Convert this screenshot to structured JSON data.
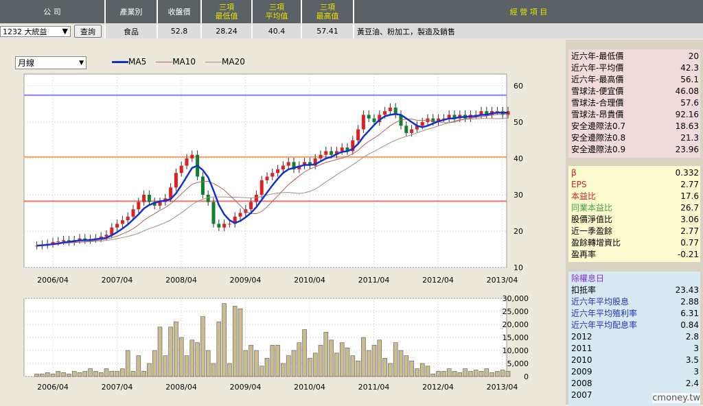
{
  "header": {
    "company": "公 司",
    "industry": "產業別",
    "close": "收盤價",
    "low3": "三項\n最低值",
    "avg3": "三項\n平均值",
    "high3": "三項\n最高值",
    "business": "經 營 項 目"
  },
  "row": {
    "stock": "1232 大統益",
    "query": "查詢",
    "industry": "食品",
    "close": "52.8",
    "low3": "28.24",
    "avg3": "40.4",
    "high3": "57.41",
    "business": "黃豆油、粉加工，製造及銷售"
  },
  "controls": {
    "period": "月線",
    "legend": [
      "MA5",
      "MA10",
      "MA20"
    ]
  },
  "colors": {
    "ma5": "#1030d0",
    "ma10": "#b06060",
    "ma20": "#a09080",
    "up": "#e02020",
    "down": "#108030",
    "hi": "#8080ff",
    "avg": "#f0a060",
    "lo": "#f07070"
  },
  "panel1": [
    [
      "近六年-最低價",
      "20"
    ],
    [
      "近六年-平均價",
      "42.3"
    ],
    [
      "近六年-最高價",
      "56.1"
    ],
    [
      "雪球法-便宜價",
      "46.08"
    ],
    [
      "雪球法-合理價",
      "57.6"
    ],
    [
      "雪球法-昂貴價",
      "92.16"
    ],
    [
      "安全邊際法0.7",
      "18.63"
    ],
    [
      "安全邊際法0.8",
      "21.3"
    ],
    [
      "安全邊際法0.9",
      "23.96"
    ]
  ],
  "panel2": [
    [
      "β",
      "0.332"
    ],
    [
      "EPS",
      "2.77"
    ],
    [
      "本益比",
      "17.6"
    ],
    [
      "同業本益比",
      "26.7"
    ],
    [
      "股價淨值比",
      "3.06"
    ],
    [
      "近一季盈餘",
      "2.77"
    ],
    [
      "盈餘轉增資比",
      "0.77"
    ],
    [
      "盈再率",
      "-0.21"
    ]
  ],
  "panel3": [
    [
      "除權息日",
      ""
    ],
    [
      "扣抵率",
      "23.43"
    ],
    [
      "近六年平均股息",
      "2.88"
    ],
    [
      "近六年平均殖利率",
      "6.31"
    ],
    [
      "近六年平均配息率",
      "0.84"
    ],
    [
      "2012",
      "2.8"
    ],
    [
      "2011",
      "3"
    ],
    [
      "2010",
      "3.5"
    ],
    [
      "2009",
      "3"
    ],
    [
      "2008",
      "2.4"
    ],
    [
      "2007",
      ""
    ]
  ],
  "watermark": "cmoney.tw",
  "chart_data": {
    "type": "candlestick",
    "x_ticks": [
      "2006/04",
      "2007/04",
      "2008/04",
      "2009/04",
      "2010/04",
      "2011/04",
      "2012/04",
      "2013/04"
    ],
    "price_ticks": [
      10,
      20,
      30,
      40,
      50,
      60
    ],
    "ylim": [
      10,
      60
    ],
    "ref_lines": {
      "high": 57.41,
      "avg": 40.4,
      "low": 28.24
    },
    "start": "2006/01",
    "closes": [
      16,
      16.2,
      16.5,
      17,
      17.2,
      17.5,
      17,
      17.5,
      18,
      17.5,
      17.8,
      18,
      18.5,
      19,
      21,
      22,
      23,
      24,
      26,
      28,
      30,
      28,
      27,
      28,
      29,
      32,
      36,
      38,
      40,
      41,
      35,
      30,
      28,
      22,
      21,
      22,
      22,
      24,
      25,
      26,
      28,
      30,
      34,
      35,
      36,
      37,
      38,
      39,
      37,
      38,
      39,
      38,
      40,
      41,
      42,
      41,
      42,
      43,
      42,
      45,
      48,
      52,
      51,
      50,
      52,
      53,
      54,
      52,
      49,
      47,
      48,
      49,
      50,
      51,
      50,
      51,
      51,
      52,
      51,
      52,
      51,
      52,
      52,
      53,
      52,
      53,
      53,
      52,
      53
    ],
    "volume": [
      1,
      1,
      1.5,
      1,
      2,
      1.5,
      1,
      2,
      1.5,
      2,
      3,
      2,
      1.5,
      3,
      2,
      2,
      3,
      10,
      2,
      8,
      2,
      5,
      10,
      19,
      8,
      19,
      21,
      15,
      8,
      14,
      13,
      23,
      10,
      5,
      21,
      28,
      5,
      27,
      26,
      10,
      12,
      10,
      4,
      7,
      12,
      12,
      5,
      8,
      10,
      13,
      18,
      7,
      9,
      12,
      17,
      14,
      9,
      13,
      11,
      8,
      6,
      15,
      10,
      12,
      14,
      7,
      5,
      13,
      10,
      8,
      6,
      3,
      5,
      4,
      1,
      2,
      2,
      3,
      2,
      1.5,
      3,
      2,
      2.5,
      2,
      3,
      1.5,
      2,
      2.5,
      2
    ],
    "vol_ticks": [
      "0",
      "5,000",
      "10,000",
      "15,000",
      "20,000",
      "25,000",
      "30,000"
    ]
  }
}
